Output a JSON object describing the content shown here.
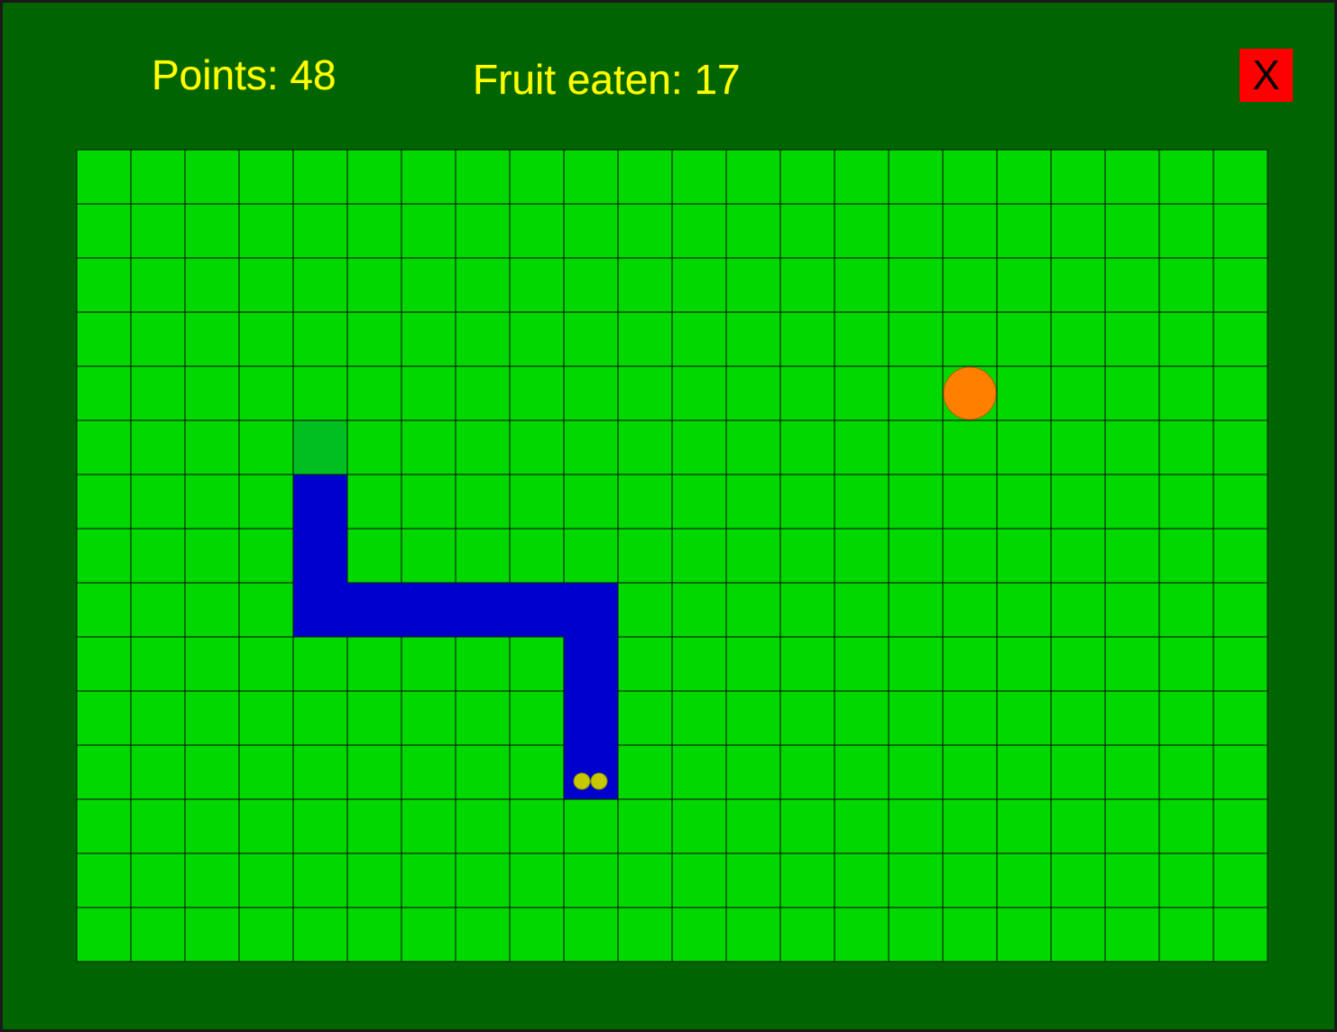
{
  "hud": {
    "points_text": "Points: 48",
    "fruit_text": "Fruit eaten: 17",
    "close_label": "X"
  },
  "board": {
    "cols": 22,
    "rows": 15,
    "colors": {
      "cell": "#00d800",
      "grid_line": "#0a2a0a",
      "snake": "#0000cc",
      "eyes": "#c8c800",
      "fruit": "#ff8000",
      "trail": "#00c020"
    },
    "snake_cells": [
      [
        4,
        6
      ],
      [
        4,
        7
      ],
      [
        4,
        8
      ],
      [
        5,
        8
      ],
      [
        6,
        8
      ],
      [
        7,
        8
      ],
      [
        8,
        8
      ],
      [
        9,
        8
      ],
      [
        9,
        9
      ],
      [
        9,
        10
      ],
      [
        9,
        11
      ]
    ],
    "snake_head": [
      9,
      11
    ],
    "fruit_cell": [
      16,
      4
    ],
    "trail_cell": [
      4,
      5
    ]
  }
}
